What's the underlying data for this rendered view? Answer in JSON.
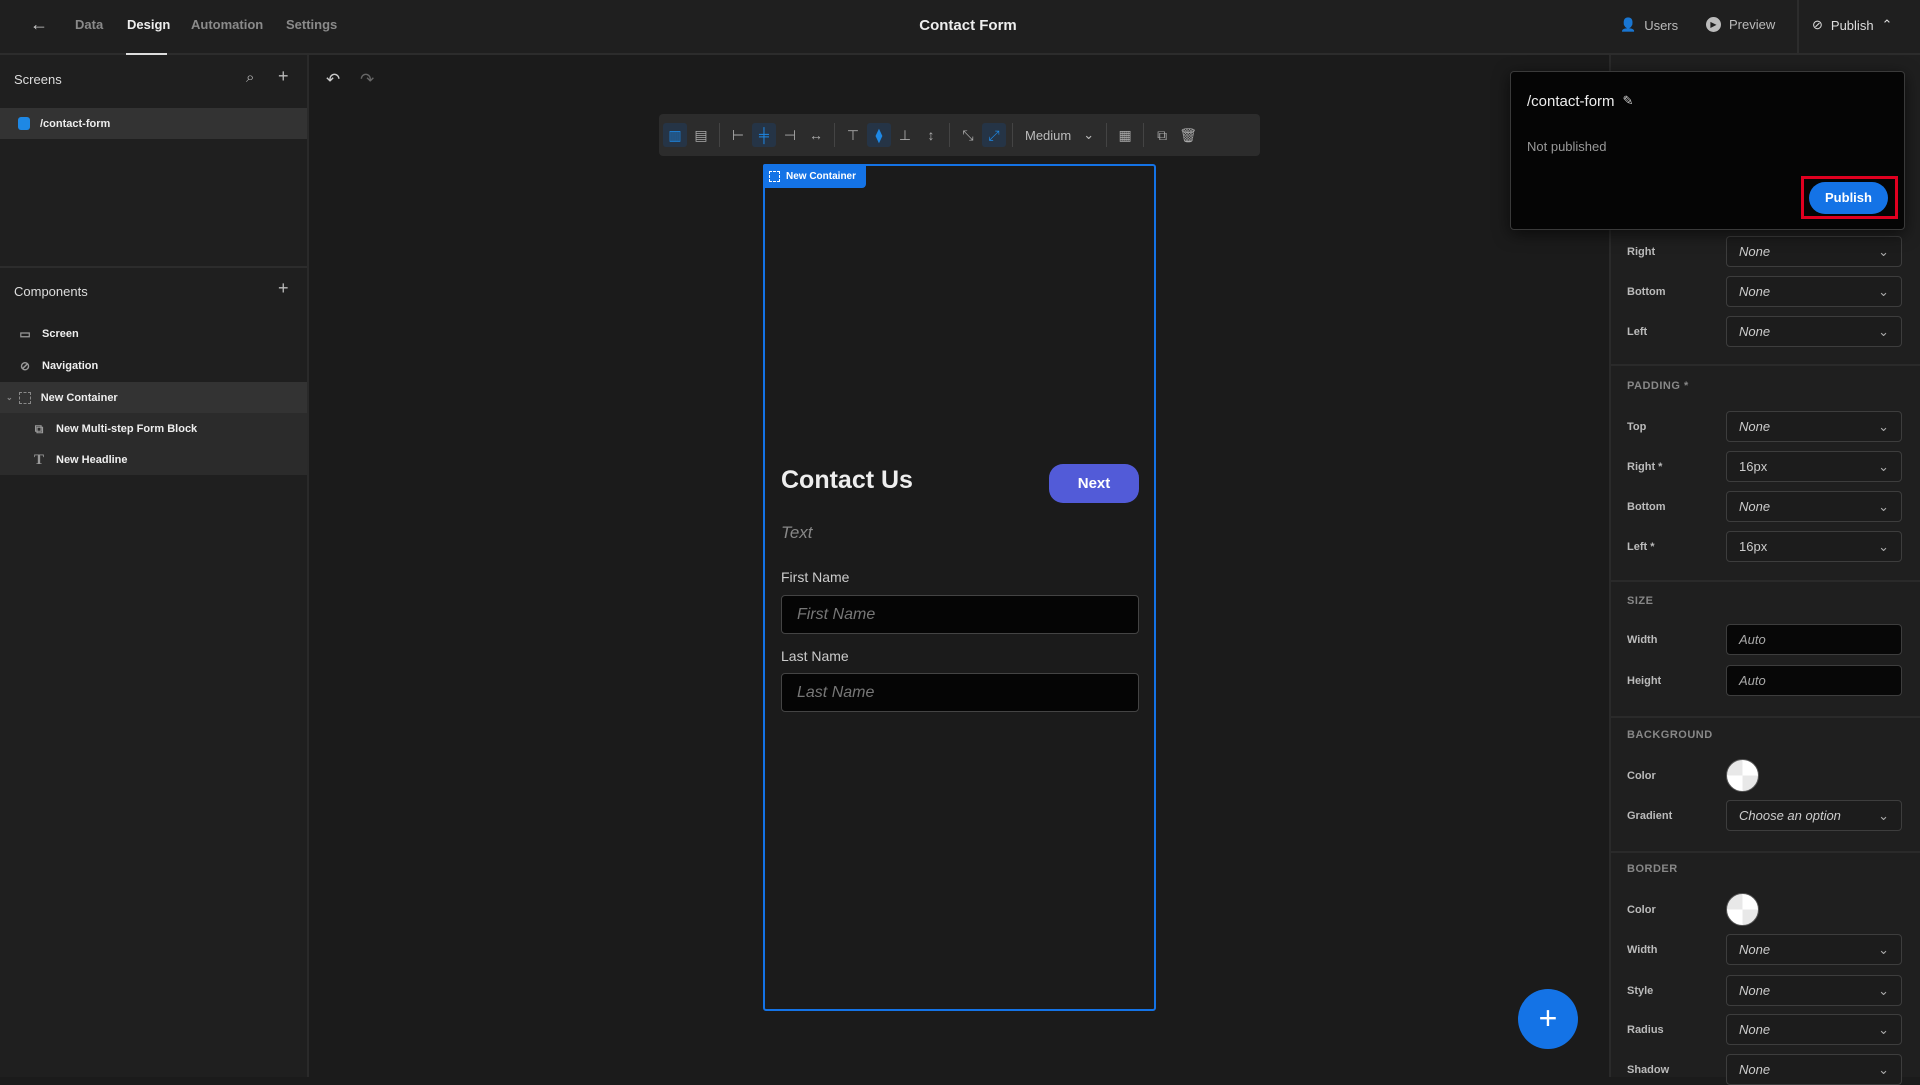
{
  "topbar": {
    "nav": [
      "Data",
      "Design",
      "Automation",
      "Settings"
    ],
    "title": "Contact Form",
    "users": "Users",
    "preview": "Preview",
    "publish": "Publish"
  },
  "sidebar": {
    "screens_title": "Screens",
    "screen_item": "/contact-form",
    "components_title": "Components",
    "components": [
      "Screen",
      "Navigation",
      "New Container",
      "New Multi-step Form Block",
      "New Headline"
    ]
  },
  "toolbar": {
    "size_select": "Medium"
  },
  "canvas": {
    "container_tag": "New Container",
    "heading": "Contact Us",
    "next": "Next",
    "text": "Text",
    "first_label": "First Name",
    "first_placeholder": "First Name",
    "last_label": "Last Name",
    "last_placeholder": "Last Name"
  },
  "popup": {
    "route": "/contact-form",
    "status": "Not published",
    "publish": "Publish"
  },
  "panel": {
    "margin": [
      {
        "label": "Right",
        "value": "None"
      },
      {
        "label": "Bottom",
        "value": "None"
      },
      {
        "label": "Left",
        "value": "None"
      }
    ],
    "padding_title": "PADDING *",
    "padding": [
      {
        "label": "Top",
        "value": "None"
      },
      {
        "label": "Right *",
        "value": "16px"
      },
      {
        "label": "Bottom",
        "value": "None"
      },
      {
        "label": "Left *",
        "value": "16px"
      }
    ],
    "size_title": "SIZE",
    "width_label": "Width",
    "width": "Auto",
    "height_label": "Height",
    "height": "Auto",
    "background_title": "BACKGROUND",
    "bg_color_label": "Color",
    "gradient_label": "Gradient",
    "gradient": "Choose an option",
    "border_title": "BORDER",
    "border_color_label": "Color",
    "border": [
      {
        "label": "Width",
        "value": "None"
      },
      {
        "label": "Style",
        "value": "None"
      },
      {
        "label": "Radius",
        "value": "None"
      },
      {
        "label": "Shadow",
        "value": "None"
      }
    ]
  },
  "colors": {
    "accent": "#1473e6",
    "next_button": "#525bd8",
    "highlight": "#e00020"
  }
}
